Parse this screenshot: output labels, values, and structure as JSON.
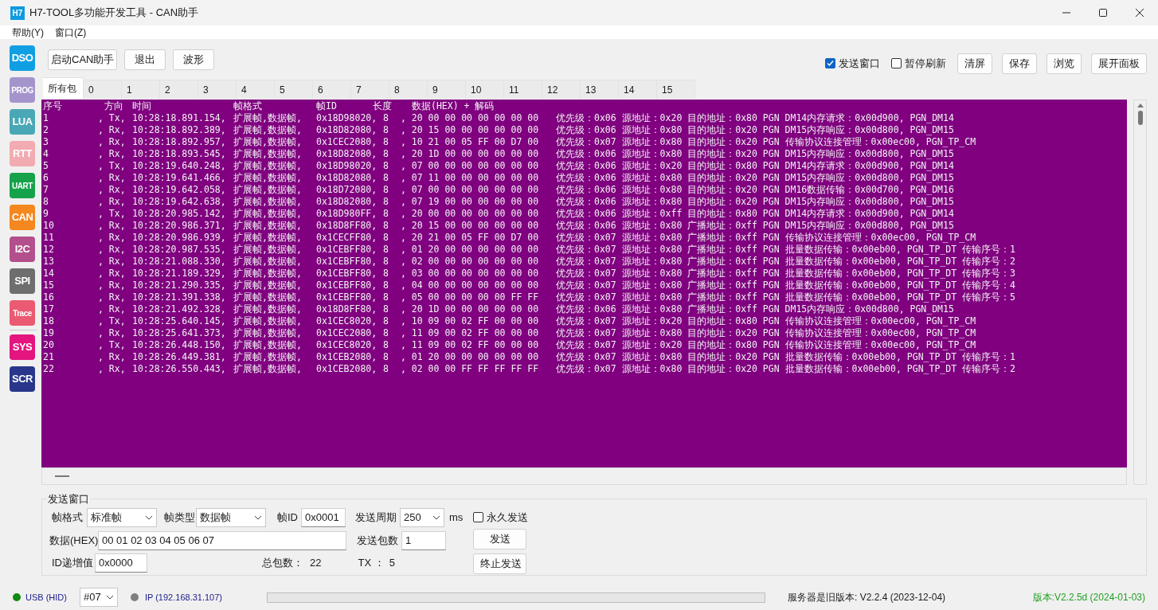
{
  "window": {
    "icon_text": "H7",
    "title": "H7-TOOL多功能开发工具 - CAN助手"
  },
  "menu": [
    "帮助(Y)",
    "窗口(Z)"
  ],
  "sidebar": {
    "items": [
      {
        "label": "DSO",
        "color": "#119fe3"
      },
      {
        "label": "PROG",
        "color": "#a594cc"
      },
      {
        "label": "LUA",
        "color": "#4aa7b5"
      },
      {
        "label": "RTT",
        "color": "#f2abb1"
      },
      {
        "label": "UART",
        "color": "#16a24b"
      },
      {
        "label": "CAN",
        "color": "#f4871f"
      },
      {
        "label": "I2C",
        "color": "#b24f8c"
      },
      {
        "label": "SPI",
        "color": "#6e6e6e"
      },
      {
        "label": "Trace",
        "color": "#ea5a72"
      },
      {
        "label": "SYS",
        "color": "#e4157f"
      },
      {
        "label": "SCR",
        "color": "#28368c"
      }
    ]
  },
  "toolbar": {
    "left_buttons": [
      "启动CAN助手",
      "退出",
      "波形"
    ],
    "checkboxes": [
      {
        "label": "发送窗口",
        "checked": true
      },
      {
        "label": "暂停刷新",
        "checked": false
      }
    ],
    "right_buttons": [
      "清屏",
      "保存",
      "浏览",
      "展开面板"
    ]
  },
  "tabs": [
    {
      "label": "所有包",
      "selected": true
    },
    {
      "label": "0",
      "selected": false
    },
    {
      "label": "1",
      "selected": false
    },
    {
      "label": "2",
      "selected": false
    },
    {
      "label": "3",
      "selected": false
    },
    {
      "label": "4",
      "selected": false
    },
    {
      "label": "5",
      "selected": false
    },
    {
      "label": "6",
      "selected": false
    },
    {
      "label": "7",
      "selected": false
    },
    {
      "label": "8",
      "selected": false
    },
    {
      "label": "9",
      "selected": false
    },
    {
      "label": "10",
      "selected": false
    },
    {
      "label": "11",
      "selected": false
    },
    {
      "label": "12",
      "selected": false
    },
    {
      "label": "13",
      "selected": false
    },
    {
      "label": "14",
      "selected": false
    },
    {
      "label": "15",
      "selected": false
    }
  ],
  "log": {
    "columns": [
      "序号",
      "方向",
      "时间",
      "帧格式",
      "帧ID",
      "长度",
      "数据(HEX) + 解码"
    ],
    "rows": [
      {
        "seq": "1",
        "dir": ", Tx,",
        "time": "10:28:18.891.154,",
        "format": "扩展帧,数据帧,",
        "id": "0x18D98020,",
        "len": "8",
        "data": ", 20 00 00 00 00 00 00 00",
        "decode": "优先级：0x06 源地址：0x20 目的地址：0x80 PGN DM14内存请求：0x00d900, PGN_DM14"
      },
      {
        "seq": "2",
        "dir": ", Rx,",
        "time": "10:28:18.892.389,",
        "format": "扩展帧,数据帧,",
        "id": "0x18D82080,",
        "len": "8",
        "data": ", 20 15 00 00 00 00 00 00",
        "decode": "优先级：0x06 源地址：0x80 目的地址：0x20 PGN DM15内存响应：0x00d800, PGN_DM15"
      },
      {
        "seq": "3",
        "dir": ", Rx,",
        "time": "10:28:18.892.957,",
        "format": "扩展帧,数据帧,",
        "id": "0x1CEC2080,",
        "len": "8",
        "data": ", 10 21 00 05 FF 00 D7 00",
        "decode": "优先级：0x07 源地址：0x80 目的地址：0x20 PGN 传输协议连接管理：0x00ec00, PGN_TP_CM"
      },
      {
        "seq": "4",
        "dir": ", Rx,",
        "time": "10:28:18.893.545,",
        "format": "扩展帧,数据帧,",
        "id": "0x18D82080,",
        "len": "8",
        "data": ", 20 1D 00 00 00 00 00 00",
        "decode": "优先级：0x06 源地址：0x80 目的地址：0x20 PGN DM15内存响应：0x00d800, PGN_DM15"
      },
      {
        "seq": "5",
        "dir": ", Tx,",
        "time": "10:28:19.640.248,",
        "format": "扩展帧,数据帧,",
        "id": "0x18D98020,",
        "len": "8",
        "data": ", 07 00 00 00 00 00 00 00",
        "decode": "优先级：0x06 源地址：0x20 目的地址：0x80 PGN DM14内存请求：0x00d900, PGN_DM14"
      },
      {
        "seq": "6",
        "dir": ", Rx,",
        "time": "10:28:19.641.466,",
        "format": "扩展帧,数据帧,",
        "id": "0x18D82080,",
        "len": "8",
        "data": ", 07 11 00 00 00 00 00 00",
        "decode": "优先级：0x06 源地址：0x80 目的地址：0x20 PGN DM15内存响应：0x00d800, PGN_DM15"
      },
      {
        "seq": "7",
        "dir": ", Rx,",
        "time": "10:28:19.642.058,",
        "format": "扩展帧,数据帧,",
        "id": "0x18D72080,",
        "len": "8",
        "data": ", 07 00 00 00 00 00 00 00",
        "decode": "优先级：0x06 源地址：0x80 目的地址：0x20 PGN DM16数据传输：0x00d700, PGN_DM16"
      },
      {
        "seq": "8",
        "dir": ", Rx,",
        "time": "10:28:19.642.638,",
        "format": "扩展帧,数据帧,",
        "id": "0x18D82080,",
        "len": "8",
        "data": ", 07 19 00 00 00 00 00 00",
        "decode": "优先级：0x06 源地址：0x80 目的地址：0x20 PGN DM15内存响应：0x00d800, PGN_DM15"
      },
      {
        "seq": "9",
        "dir": ", Tx,",
        "time": "10:28:20.985.142,",
        "format": "扩展帧,数据帧,",
        "id": "0x18D980FF,",
        "len": "8",
        "data": ", 20 00 00 00 00 00 00 00",
        "decode": "优先级：0x06 源地址：0xff 目的地址：0x80 PGN DM14内存请求：0x00d900, PGN_DM14"
      },
      {
        "seq": "10",
        "dir": ", Rx,",
        "time": "10:28:20.986.371,",
        "format": "扩展帧,数据帧,",
        "id": "0x18D8FF80,",
        "len": "8",
        "data": ", 20 15 00 00 00 00 00 00",
        "decode": "优先级：0x06 源地址：0x80 广播地址：0xff PGN DM15内存响应：0x00d800, PGN_DM15"
      },
      {
        "seq": "11",
        "dir": ", Rx,",
        "time": "10:28:20.986.939,",
        "format": "扩展帧,数据帧,",
        "id": "0x1CECFF80,",
        "len": "8",
        "data": ", 20 21 00 05 FF 00 D7 00",
        "decode": "优先级：0x07 源地址：0x80 广播地址：0xff PGN 传输协议连接管理：0x00ec00, PGN_TP_CM"
      },
      {
        "seq": "12",
        "dir": ", Rx,",
        "time": "10:28:20.987.535,",
        "format": "扩展帧,数据帧,",
        "id": "0x1CEBFF80,",
        "len": "8",
        "data": ", 01 20 00 00 00 00 00 00",
        "decode": "优先级：0x07 源地址：0x80 广播地址：0xff PGN 批量数据传输：0x00eb00, PGN_TP_DT 传输序号：1"
      },
      {
        "seq": "13",
        "dir": ", Rx,",
        "time": "10:28:21.088.330,",
        "format": "扩展帧,数据帧,",
        "id": "0x1CEBFF80,",
        "len": "8",
        "data": ", 02 00 00 00 00 00 00 00",
        "decode": "优先级：0x07 源地址：0x80 广播地址：0xff PGN 批量数据传输：0x00eb00, PGN_TP_DT 传输序号：2"
      },
      {
        "seq": "14",
        "dir": ", Rx,",
        "time": "10:28:21.189.329,",
        "format": "扩展帧,数据帧,",
        "id": "0x1CEBFF80,",
        "len": "8",
        "data": ", 03 00 00 00 00 00 00 00",
        "decode": "优先级：0x07 源地址：0x80 广播地址：0xff PGN 批量数据传输：0x00eb00, PGN_TP_DT 传输序号：3"
      },
      {
        "seq": "15",
        "dir": ", Rx,",
        "time": "10:28:21.290.335,",
        "format": "扩展帧,数据帧,",
        "id": "0x1CEBFF80,",
        "len": "8",
        "data": ", 04 00 00 00 00 00 00 00",
        "decode": "优先级：0x07 源地址：0x80 广播地址：0xff PGN 批量数据传输：0x00eb00, PGN_TP_DT 传输序号：4"
      },
      {
        "seq": "16",
        "dir": ", Rx,",
        "time": "10:28:21.391.338,",
        "format": "扩展帧,数据帧,",
        "id": "0x1CEBFF80,",
        "len": "8",
        "data": ", 05 00 00 00 00 00 FF FF",
        "decode": "优先级：0x07 源地址：0x80 广播地址：0xff PGN 批量数据传输：0x00eb00, PGN_TP_DT 传输序号：5"
      },
      {
        "seq": "17",
        "dir": ", Rx,",
        "time": "10:28:21.492.328,",
        "format": "扩展帧,数据帧,",
        "id": "0x18D8FF80,",
        "len": "8",
        "data": ", 20 1D 00 00 00 00 00 00",
        "decode": "优先级：0x06 源地址：0x80 广播地址：0xff PGN DM15内存响应：0x00d800, PGN_DM15"
      },
      {
        "seq": "18",
        "dir": ", Tx,",
        "time": "10:28:25.640.145,",
        "format": "扩展帧,数据帧,",
        "id": "0x1CEC8020,",
        "len": "8",
        "data": ", 10 09 00 02 FF 00 00 00",
        "decode": "优先级：0x07 源地址：0x20 目的地址：0x80 PGN 传输协议连接管理：0x00ec00, PGN_TP_CM"
      },
      {
        "seq": "19",
        "dir": ", Rx,",
        "time": "10:28:25.641.373,",
        "format": "扩展帧,数据帧,",
        "id": "0x1CEC2080,",
        "len": "8",
        "data": ", 11 09 00 02 FF 00 00 00",
        "decode": "优先级：0x07 源地址：0x80 目的地址：0x20 PGN 传输协议连接管理：0x00ec00, PGN_TP_CM"
      },
      {
        "seq": "20",
        "dir": ", Tx,",
        "time": "10:28:26.448.150,",
        "format": "扩展帧,数据帧,",
        "id": "0x1CEC8020,",
        "len": "8",
        "data": ", 11 09 00 02 FF 00 00 00",
        "decode": "优先级：0x07 源地址：0x20 目的地址：0x80 PGN 传输协议连接管理：0x00ec00, PGN_TP_CM"
      },
      {
        "seq": "21",
        "dir": ", Rx,",
        "time": "10:28:26.449.381,",
        "format": "扩展帧,数据帧,",
        "id": "0x1CEB2080,",
        "len": "8",
        "data": ", 01 20 00 00 00 00 00 00",
        "decode": "优先级：0x07 源地址：0x80 目的地址：0x20 PGN 批量数据传输：0x00eb00, PGN_TP_DT 传输序号：1"
      },
      {
        "seq": "22",
        "dir": ", Rx,",
        "time": "10:28:26.550.443,",
        "format": "扩展帧,数据帧,",
        "id": "0x1CEB2080,",
        "len": "8",
        "data": ", 02 00 00 FF FF FF FF FF",
        "decode": "优先级：0x07 源地址：0x80 目的地址：0x20 PGN 批量数据传输：0x00eb00, PGN_TP_DT 传输序号：2"
      }
    ]
  },
  "send_window": {
    "title": "发送窗口",
    "frame_format": {
      "label": "帧格式",
      "value": "标准帧"
    },
    "frame_type": {
      "label": "帧类型",
      "value": "数据帧"
    },
    "frame_id": {
      "label": "帧ID",
      "value": "0x0001"
    },
    "period": {
      "label": "发送周期",
      "value": "250",
      "unit": "ms"
    },
    "forever": {
      "label": "永久发送",
      "checked": false
    },
    "data": {
      "label": "数据(HEX)",
      "value": "00 01 02 03 04 05 06 07"
    },
    "count": {
      "label": "发送包数",
      "value": "1"
    },
    "send_button": "发送",
    "id_step": {
      "label": "ID递增值",
      "value": "0x0000"
    },
    "total": {
      "label": "总包数：",
      "value": "22"
    },
    "tx": {
      "label": "TX ：",
      "value": "5"
    },
    "stop_button": "终止发送"
  },
  "status_bar": {
    "usb": {
      "label": "USB (HID)",
      "color": "#108a10"
    },
    "port": "#07",
    "ip": {
      "label": "IP (192.168.31.107)",
      "color": "#7f7f7f"
    },
    "server": "服务器是旧版本: V2.2.4 (2023-12-04)",
    "version": "版本:V2.2.5d (2024-01-03)"
  }
}
